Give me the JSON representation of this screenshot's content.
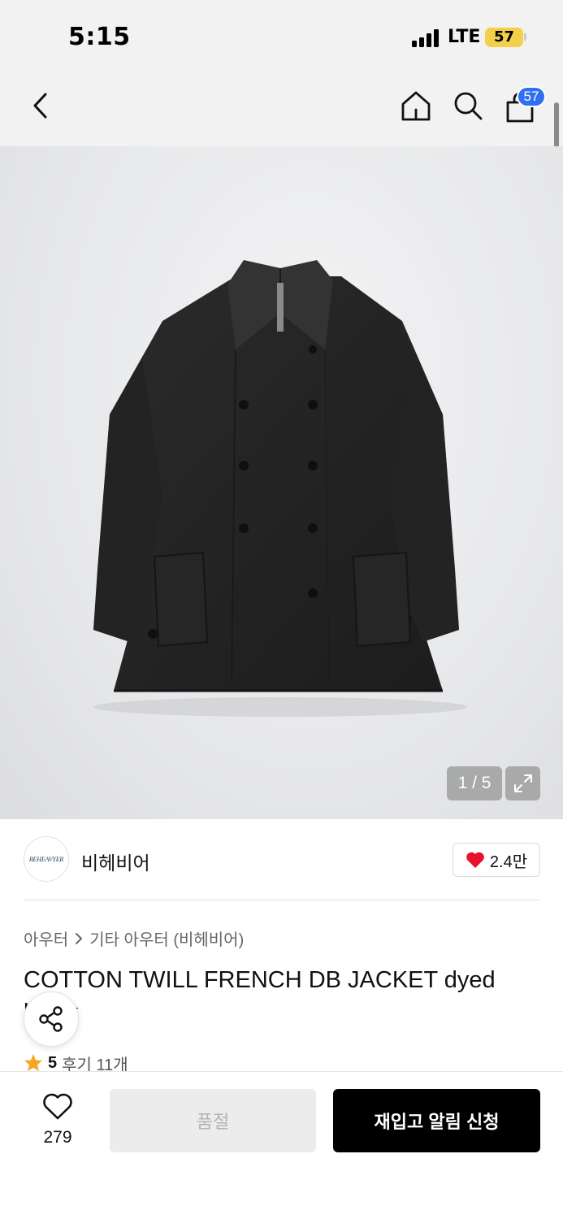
{
  "status_bar": {
    "time": "5:15",
    "network": "LTE",
    "battery": "57"
  },
  "nav": {
    "back_icon": "chevron-left-icon",
    "home_icon": "home-icon",
    "search_icon": "search-icon",
    "cart_icon": "shopping-bag-icon",
    "cart_count": "57",
    "cart_badge_color": "#2f6ff2"
  },
  "gallery": {
    "counter": "1 / 5",
    "expand_icon": "expand-icon"
  },
  "brand": {
    "logo_text": "BEHEAVYER",
    "name": "비헤비어",
    "likes": "2.4만",
    "heart_color": "#e8112d"
  },
  "breadcrumb": {
    "category": "아우터",
    "separator_icon": "chevron-right-icon",
    "subcategory": "기타 아우터 (비헤비어)"
  },
  "product": {
    "title": "COTTON TWILL FRENCH DB JACKET dyed black",
    "rating": "5",
    "review_label": "후기 11개",
    "star_color": "#f5a623"
  },
  "bottom_bar": {
    "wish_count": "279",
    "soldout_label": "품절",
    "restock_label": "재입고 알림 신청"
  }
}
